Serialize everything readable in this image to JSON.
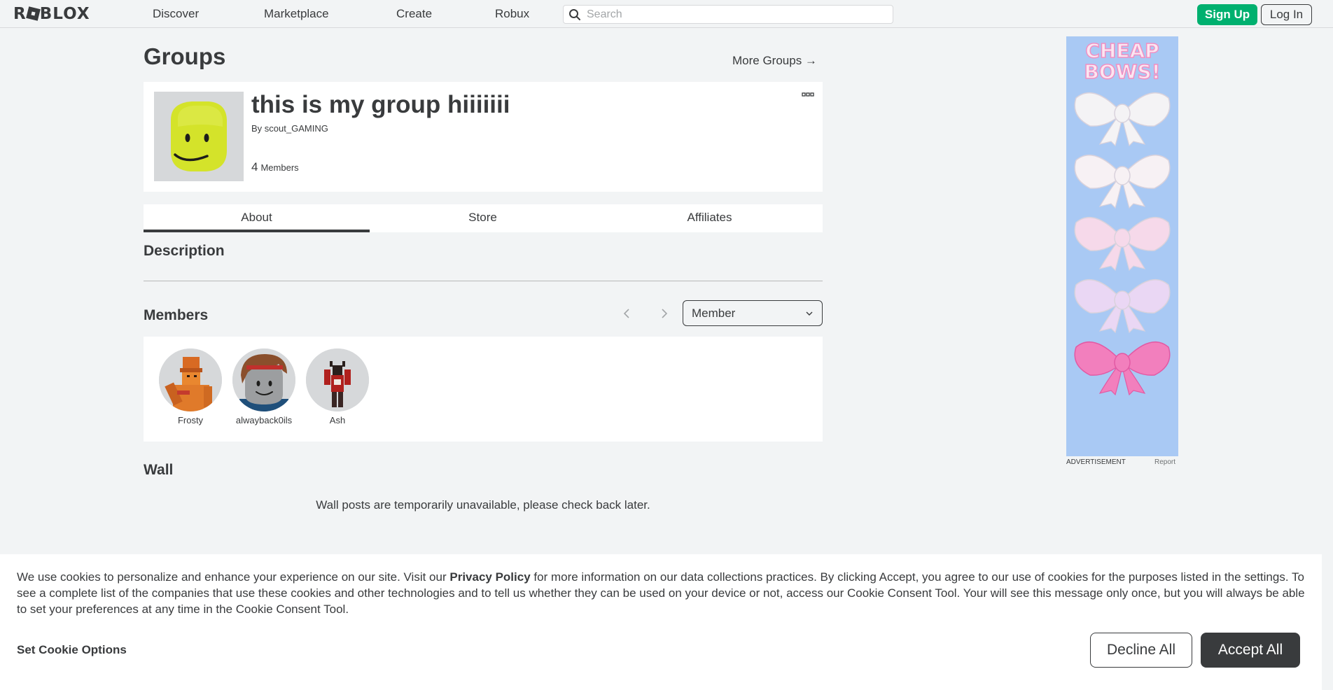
{
  "nav": {
    "logo": "ROBLOX",
    "links": [
      "Discover",
      "Marketplace",
      "Create",
      "Robux"
    ],
    "search_placeholder": "Search",
    "signup": "Sign Up",
    "login": "Log In"
  },
  "header": {
    "title": "Groups",
    "more_groups": "More Groups →"
  },
  "group": {
    "name": "this is my group hiiiiiii",
    "owner_prefix": "By",
    "owner": "scout_GAMING",
    "member_count": "4",
    "member_label": "Members",
    "emblem_icon": "yellow-noob-face-icon"
  },
  "tabs": [
    "About",
    "Store",
    "Affiliates"
  ],
  "active_tab": "About",
  "about": {
    "description_title": "Description",
    "members_title": "Members",
    "role_select": "Member",
    "members": [
      {
        "name": "Frosty",
        "avatar": "orange-avatar-icon"
      },
      {
        "name": "alwayback0ils",
        "avatar": "classic-face-avatar-icon"
      },
      {
        "name": "Ash",
        "avatar": "red-dark-avatar-icon"
      }
    ],
    "wall_title": "Wall",
    "wall_message": "Wall posts are temporarily unavailable, please check back later."
  },
  "ad": {
    "headline_line1": "CHEAP",
    "headline_line2": "BOWS!",
    "label": "ADVERTISEMENT",
    "report": "Report",
    "bow_colors": [
      "#f4f3f5",
      "#f7f1f4",
      "#f6d9ea",
      "#ead7f4",
      "#f27fbd"
    ]
  },
  "cookie": {
    "text_before": "We use cookies to personalize and enhance your experience on our site. Visit our ",
    "privacy_link": "Privacy Policy",
    "text_after": " for more information on our data collections practices. By clicking Accept, you agree to our use of cookies for the purposes listed in the settings. To see a complete list of the companies that use these cookies and other technologies and to tell us whether they can be used on your device or not, access our Cookie Consent Tool. Your will see this message only once, but you will always be able to set your preferences at any time in the Cookie Consent Tool.",
    "options": "Set Cookie Options",
    "decline": "Decline All",
    "accept": "Accept All"
  },
  "colors": {
    "text": "#393b3d",
    "background": "#f2f4f5",
    "signup_green": "#00b06f",
    "accept_dark": "#393b3d"
  }
}
